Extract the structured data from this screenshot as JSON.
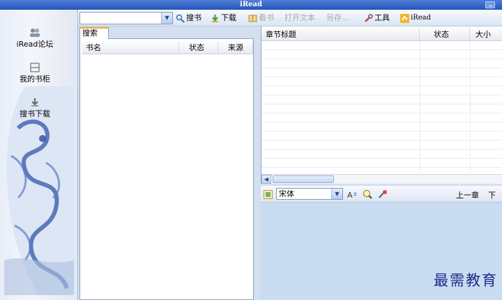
{
  "window": {
    "title": "iRead"
  },
  "toolbar": {
    "search_value": "",
    "buttons": [
      {
        "label": "搜书",
        "icon": "magnifier-icon",
        "enabled": true
      },
      {
        "label": "下载",
        "icon": "download-arrow-icon",
        "enabled": true
      },
      {
        "label": "看书",
        "icon": "book-icon",
        "enabled": false
      },
      {
        "label": "打开文本",
        "icon": "",
        "enabled": false
      },
      {
        "label": "另存...",
        "icon": "",
        "enabled": false
      },
      {
        "label": "工具",
        "icon": "wrench-icon",
        "enabled": true
      },
      {
        "label": "iRead",
        "icon": "iread-logo-icon",
        "enabled": true
      }
    ]
  },
  "sidebar": {
    "items": [
      {
        "label": "iRead论坛",
        "icon": "people-icon"
      },
      {
        "label": "我的书柜",
        "icon": "bookshelf-icon"
      },
      {
        "label": "搜书下载",
        "icon": "download-icon"
      }
    ]
  },
  "search_panel": {
    "tab_label": "搜索",
    "columns": [
      "书名",
      "状态",
      "来源"
    ],
    "rows": []
  },
  "chapter_panel": {
    "columns": [
      "章节标题",
      "状态",
      "大小"
    ],
    "rows": []
  },
  "reader": {
    "font": "宋体",
    "prev_label": "上一章",
    "next_label": "下"
  },
  "watermark": "最需教育",
  "colors": {
    "title_bar": "#2a5cbf",
    "reader_bg": "#c9dcf0",
    "tab_accent": "#f0a628"
  }
}
